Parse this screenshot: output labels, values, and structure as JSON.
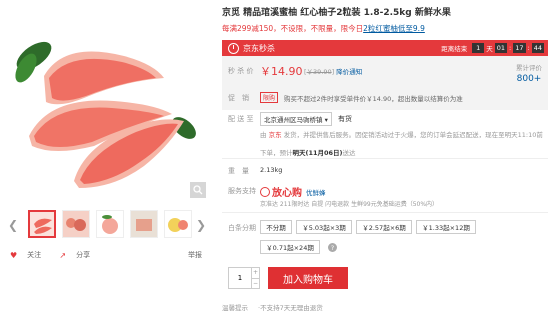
{
  "product": {
    "title": "京觅 精品琯溪蜜柚 红心柚子2粒装 1.8-2.5kg 新鲜水果",
    "promo": "每满299减150，不设限，不限量，限今日",
    "promo_link": "2粒红蜜柚低至9.9"
  },
  "seckill": {
    "label": "京东秒杀",
    "countdown_label": "距离结束",
    "days": "1",
    "days_unit": "天",
    "hours": "01",
    "minutes": "17",
    "seconds": "44"
  },
  "price": {
    "label": "秒 杀 价",
    "current": "￥14.90",
    "original": "￥39.90",
    "notice": "降价通知",
    "eval_label": "累计评价",
    "eval_count": "800+",
    "promo_label": "促　销",
    "limit_tag": "限购",
    "limit_text": "购买不超过2件时享受单件价￥14.90，超出数量以结算价为准"
  },
  "delivery": {
    "label": "配 送 至",
    "address": "北京通州区马驹桥镇",
    "stock": "有货",
    "ship_prefix": "由",
    "ship_jd": "京东",
    "ship_rest": "发货，并提供售后服务。因促销活动过于火爆，您的订单会延迟配送，现在至明天11:10前",
    "ship_line2a": "下单，预计",
    "ship_line2b": "明天(11月06日)",
    "ship_line2c": "送达"
  },
  "weight": {
    "label": "重　量",
    "value": "2.13kg"
  },
  "service": {
    "label": "服务支持",
    "brand": "放心购",
    "sub": "优鲜蜂",
    "desc": "京准达 211限时达 自提 闪电退款 生鲜99元免基础运费（50%内）"
  },
  "installments": {
    "label": "白条分期",
    "options": [
      "不分期",
      "￥5.03起×3期",
      "￥2.57起×6期",
      "￥1.33起×12期",
      "￥0.71起×24期"
    ]
  },
  "cart": {
    "quantity": "1",
    "button": "加入购物车"
  },
  "warm": {
    "label": "温馨提示",
    "text": "·不支持7天无理由退货"
  },
  "left": {
    "follow": "关注",
    "share": "分享",
    "report": "举报"
  },
  "colors": {
    "accent": "#e4393c",
    "link": "#005aa0"
  }
}
